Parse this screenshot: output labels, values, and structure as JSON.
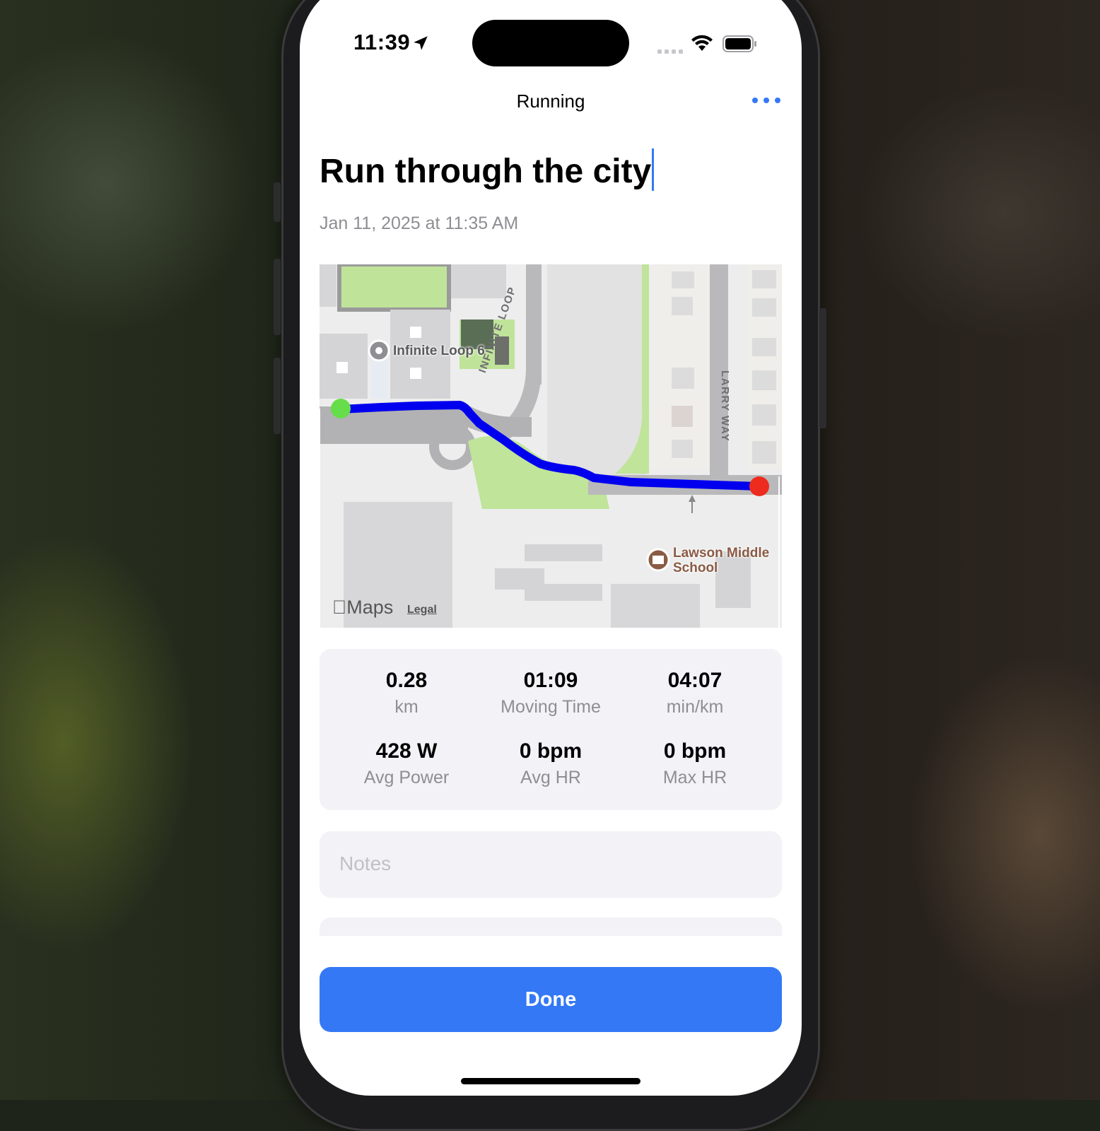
{
  "status_bar": {
    "time": "11:39",
    "location_icon": "location-arrow-icon",
    "signal_icon": "cellular-signal-icon",
    "wifi_icon": "wifi-icon",
    "battery_icon": "battery-icon"
  },
  "nav": {
    "title": "Running",
    "more_icon": "ellipsis-icon"
  },
  "activity": {
    "title": "Run through the city",
    "date": "Jan 11, 2025 at 11:35 AM"
  },
  "map": {
    "poi_infinite_loop": "Infinite Loop 6",
    "street_infinite_loop": "INFINITE LOOP",
    "street_larry_way": "LARRY WAY",
    "poi_school_line1": "Lawson Middle",
    "poi_school_line2": "School",
    "attribution": "Maps",
    "legal": "Legal",
    "route_color": "#0000ee",
    "start_color": "#4cd964",
    "end_color": "#ee2b1f"
  },
  "stats": [
    {
      "value": "0.28",
      "label": "km"
    },
    {
      "value": "01:09",
      "label": "Moving Time"
    },
    {
      "value": "04:07",
      "label": "min/km"
    },
    {
      "value": "428 W",
      "label": "Avg Power"
    },
    {
      "value": "0 bpm",
      "label": "Avg HR"
    },
    {
      "value": "0 bpm",
      "label": "Max HR"
    }
  ],
  "notes": {
    "placeholder": "Notes"
  },
  "done_button": {
    "label": "Done"
  },
  "colors": {
    "accent": "#3478f6",
    "secondary_text": "#8e8e93",
    "panel": "#f2f2f7"
  }
}
